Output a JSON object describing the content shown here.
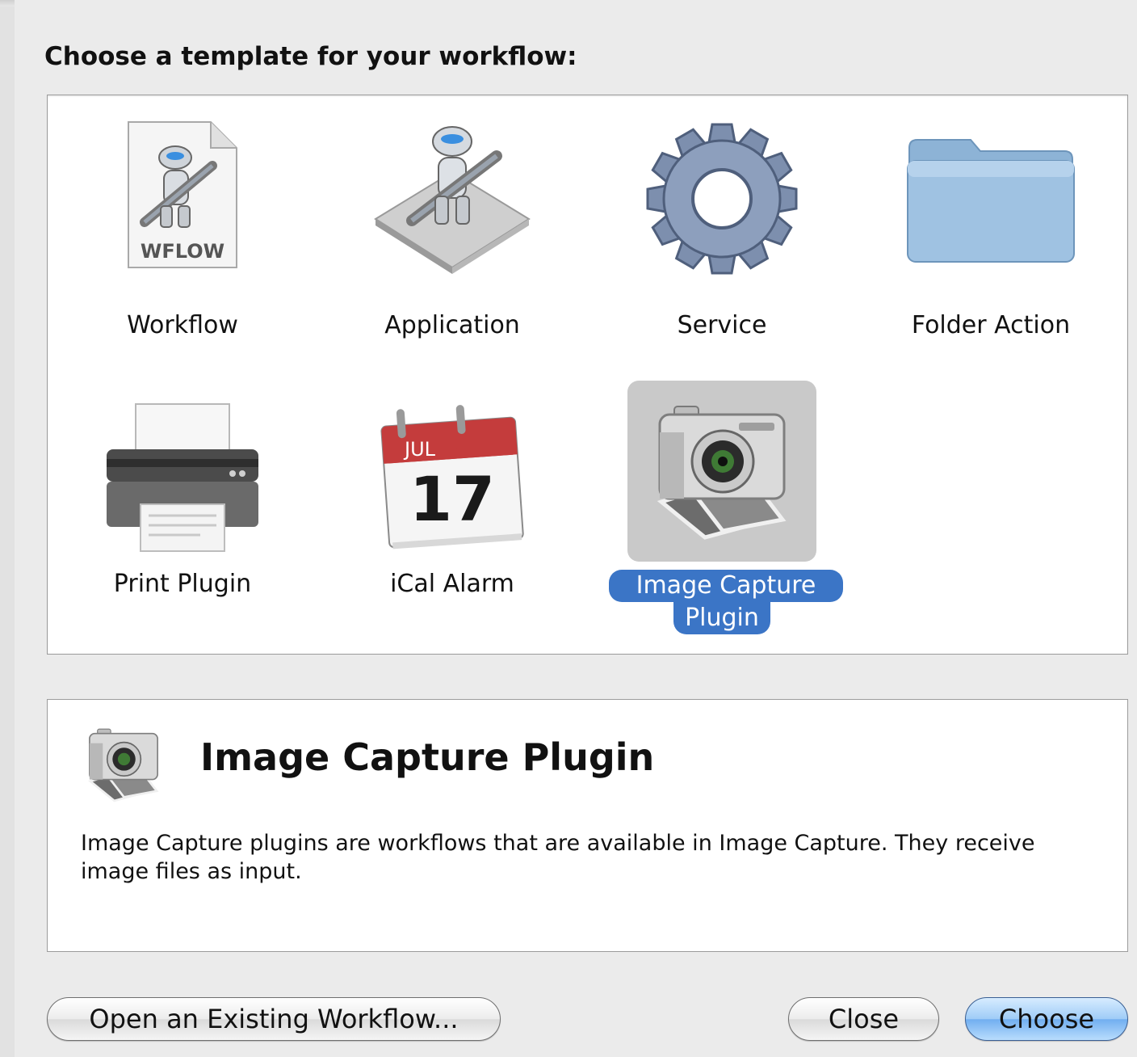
{
  "dialog": {
    "prompt": "Choose a template for your workflow:"
  },
  "templates": [
    {
      "label": "Workflow",
      "icon": "workflow-document-icon",
      "badge": "WFLOW"
    },
    {
      "label": "Application",
      "icon": "automator-robot-icon"
    },
    {
      "label": "Service",
      "icon": "gear-icon"
    },
    {
      "label": "Folder Action",
      "icon": "folder-icon"
    },
    {
      "label": "Print Plugin",
      "icon": "printer-icon"
    },
    {
      "label": "iCal Alarm",
      "icon": "calendar-icon",
      "month": "JUL",
      "day": "17"
    },
    {
      "label_line1": "Image Capture",
      "label_line2": "Plugin",
      "icon": "camera-icon",
      "selected": true
    }
  ],
  "description": {
    "title": "Image Capture Plugin",
    "text": "Image Capture plugins are workflows that are available in Image Capture. They receive image files as input."
  },
  "buttons": {
    "open_existing": "Open an Existing Workflow...",
    "close": "Close",
    "choose": "Choose"
  },
  "colors": {
    "selection": "#3b75c6",
    "selection_bg": "#c9c9c9",
    "primary_button": "#71aef0"
  }
}
